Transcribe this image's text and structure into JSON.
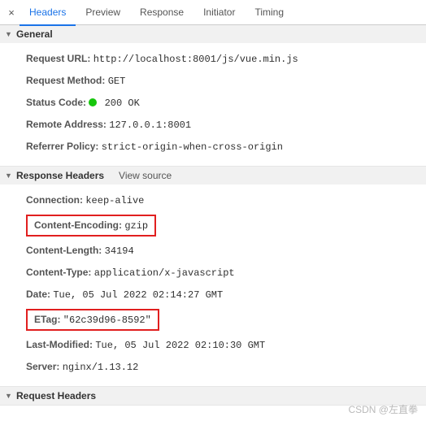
{
  "tabs": {
    "close": "×",
    "items": [
      "Headers",
      "Preview",
      "Response",
      "Initiator",
      "Timing"
    ]
  },
  "sections": {
    "general": {
      "title": "General",
      "items": {
        "request_url_k": "Request URL:",
        "request_url_v": "http://localhost:8001/js/vue.min.js",
        "request_method_k": "Request Method:",
        "request_method_v": "GET",
        "status_code_k": "Status Code:",
        "status_code_v": "200 OK",
        "remote_addr_k": "Remote Address:",
        "remote_addr_v": "127.0.0.1:8001",
        "referrer_k": "Referrer Policy:",
        "referrer_v": "strict-origin-when-cross-origin"
      }
    },
    "response": {
      "title": "Response Headers",
      "view_source": "View source",
      "items": {
        "connection_k": "Connection:",
        "connection_v": "keep-alive",
        "cenc_k": "Content-Encoding:",
        "cenc_v": "gzip",
        "clen_k": "Content-Length:",
        "clen_v": "34194",
        "ctype_k": "Content-Type:",
        "ctype_v": "application/x-javascript",
        "date_k": "Date:",
        "date_v": "Tue, 05 Jul 2022 02:14:27 GMT",
        "etag_k": "ETag:",
        "etag_v": "\"62c39d96-8592\"",
        "lm_k": "Last-Modified:",
        "lm_v": "Tue, 05 Jul 2022 02:10:30 GMT",
        "server_k": "Server:",
        "server_v": "nginx/1.13.12"
      }
    },
    "request": {
      "title": "Request Headers"
    }
  },
  "watermark": "CSDN @左直拳"
}
